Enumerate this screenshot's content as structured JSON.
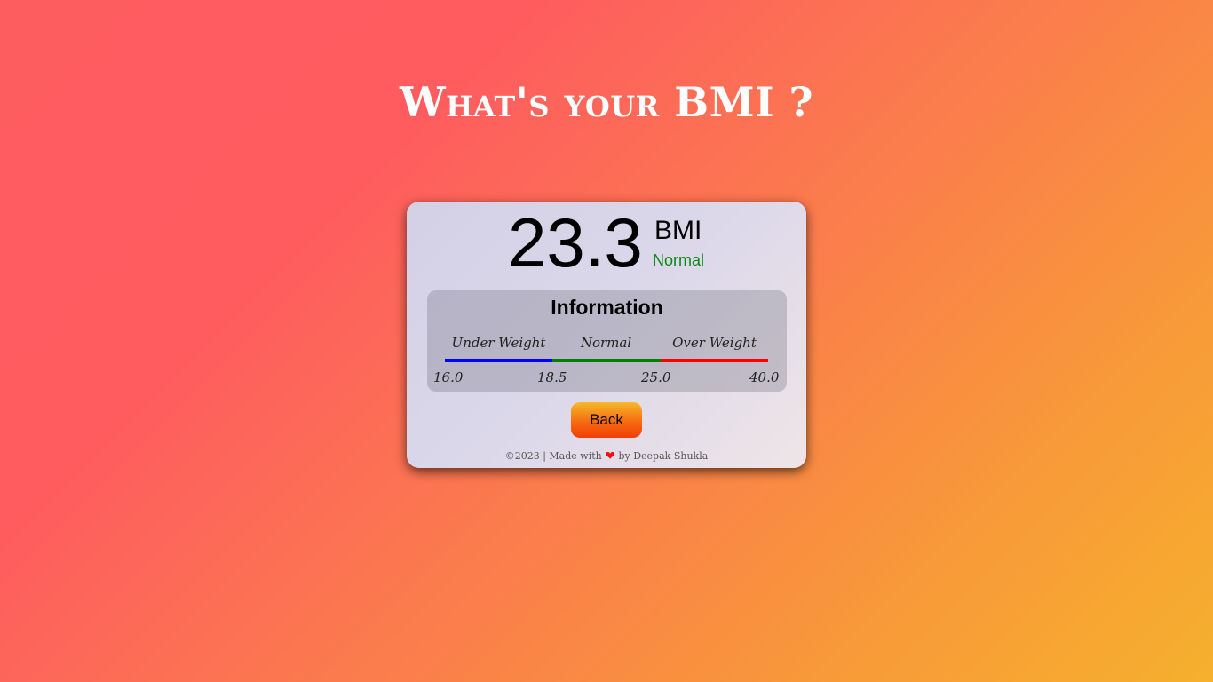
{
  "page": {
    "title": "What's your BMI ?"
  },
  "result": {
    "value": "23.3",
    "label": "BMI",
    "category": "Normal",
    "category_color": "#0b8a14"
  },
  "information": {
    "title": "Information",
    "ranges": [
      {
        "label": "Under Weight",
        "color": "#0000ff"
      },
      {
        "label": "Normal",
        "color": "#008000"
      },
      {
        "label": "Over Weight",
        "color": "#ff0000"
      }
    ],
    "ticks": [
      "16.0",
      "18.5",
      "25.0",
      "40.0"
    ]
  },
  "actions": {
    "back_label": "Back"
  },
  "footer": {
    "prefix": "©2023 | Made with",
    "heart_icon": "heart-icon",
    "suffix": "by Deepak Shukla"
  }
}
